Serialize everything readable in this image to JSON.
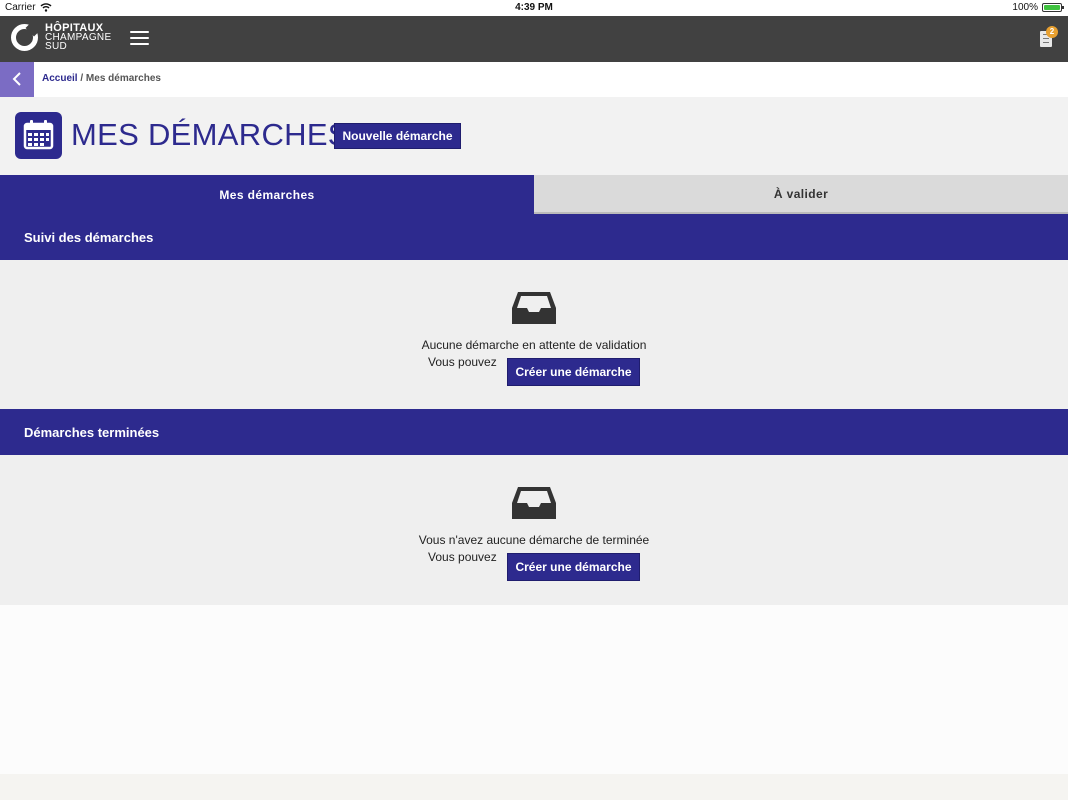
{
  "statusbar": {
    "carrier": "Carrier",
    "time": "4:39 PM",
    "battery": "100%"
  },
  "header": {
    "logo_line1": "HÔPITAUX",
    "logo_line2": "CHAMPAGNE",
    "logo_line3": "SUD",
    "notification_count": "2"
  },
  "breadcrumb": {
    "home": "Accueil",
    "separator": "/",
    "current": "Mes démarches"
  },
  "page": {
    "title": "MES DÉMARCHES",
    "new_button": "Nouvelle démarche"
  },
  "tabs": [
    {
      "label": "Mes démarches",
      "active": true
    },
    {
      "label": "À valider",
      "active": false
    }
  ],
  "sections": [
    {
      "title": "Suivi des démarches",
      "empty_message": "Aucune démarche en attente de validation",
      "prompt": "Vous pouvez",
      "button": "Créer une démarche"
    },
    {
      "title": "Démarches terminées",
      "empty_message": "Vous n'avez aucune démarche de terminée",
      "prompt": "Vous pouvez",
      "button": "Créer une démarche"
    }
  ],
  "colors": {
    "primary": "#2d2a8e",
    "appbar": "#414141",
    "back_button": "#7b6cc4",
    "badge": "#e8a030"
  }
}
